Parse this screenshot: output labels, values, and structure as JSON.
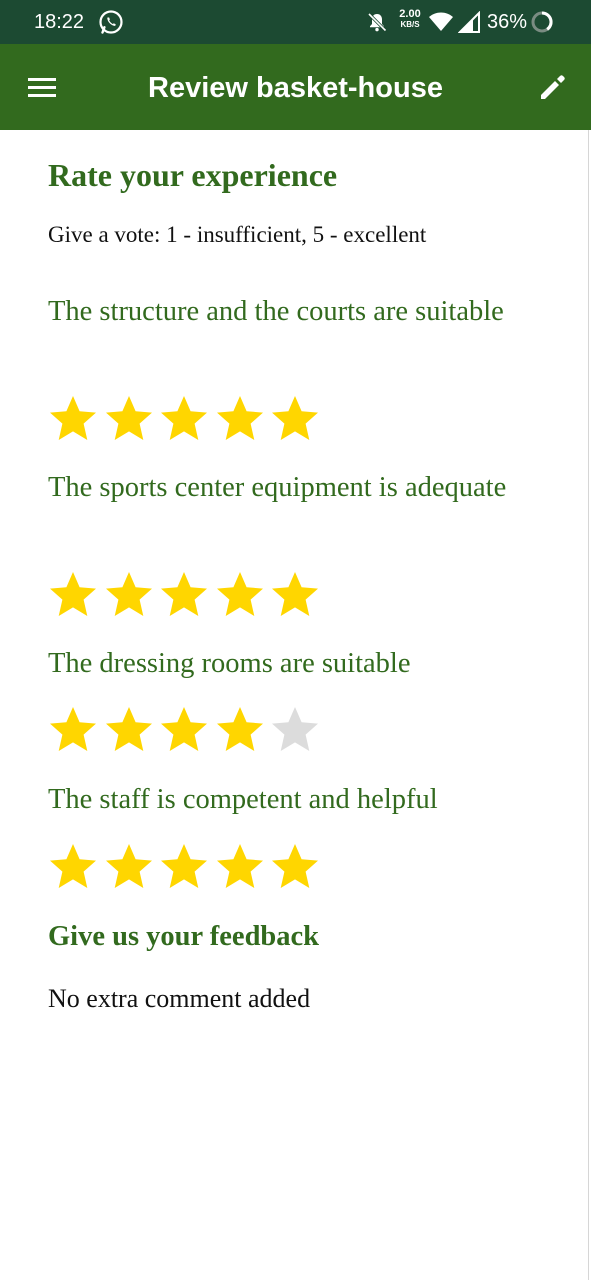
{
  "status_bar": {
    "time": "18:22",
    "net_speed_value": "2.00",
    "net_speed_unit": "KB/S",
    "battery": "36%",
    "icons": [
      "whatsapp-icon",
      "bell-off-icon",
      "wifi-icon",
      "signal-icon",
      "battery-icon"
    ]
  },
  "app_bar": {
    "title": "Review basket-house",
    "left_icon": "menu-icon",
    "right_icon": "edit-icon",
    "color": "#326a1e"
  },
  "rating_section": {
    "title": "Rate your experience",
    "instructions": "Give a vote: 1 - insufficient, 5 - excellent",
    "questions": [
      {
        "label": "The structure and the courts are suitable",
        "rating": 5,
        "max": 5
      },
      {
        "label": "The sports center equipment is adequate",
        "rating": 5,
        "max": 5
      },
      {
        "label": "The dressing rooms are suitable",
        "rating": 4,
        "max": 5
      },
      {
        "label": "The staff is competent and helpful",
        "rating": 5,
        "max": 5
      }
    ]
  },
  "feedback_section": {
    "title": "Give us your feedback",
    "comment": "No extra comment added"
  },
  "colors": {
    "status_bar": "#1c4a32",
    "accent": "#326a1e",
    "star_filled": "#ffd600",
    "star_empty": "#dcdcdc"
  }
}
